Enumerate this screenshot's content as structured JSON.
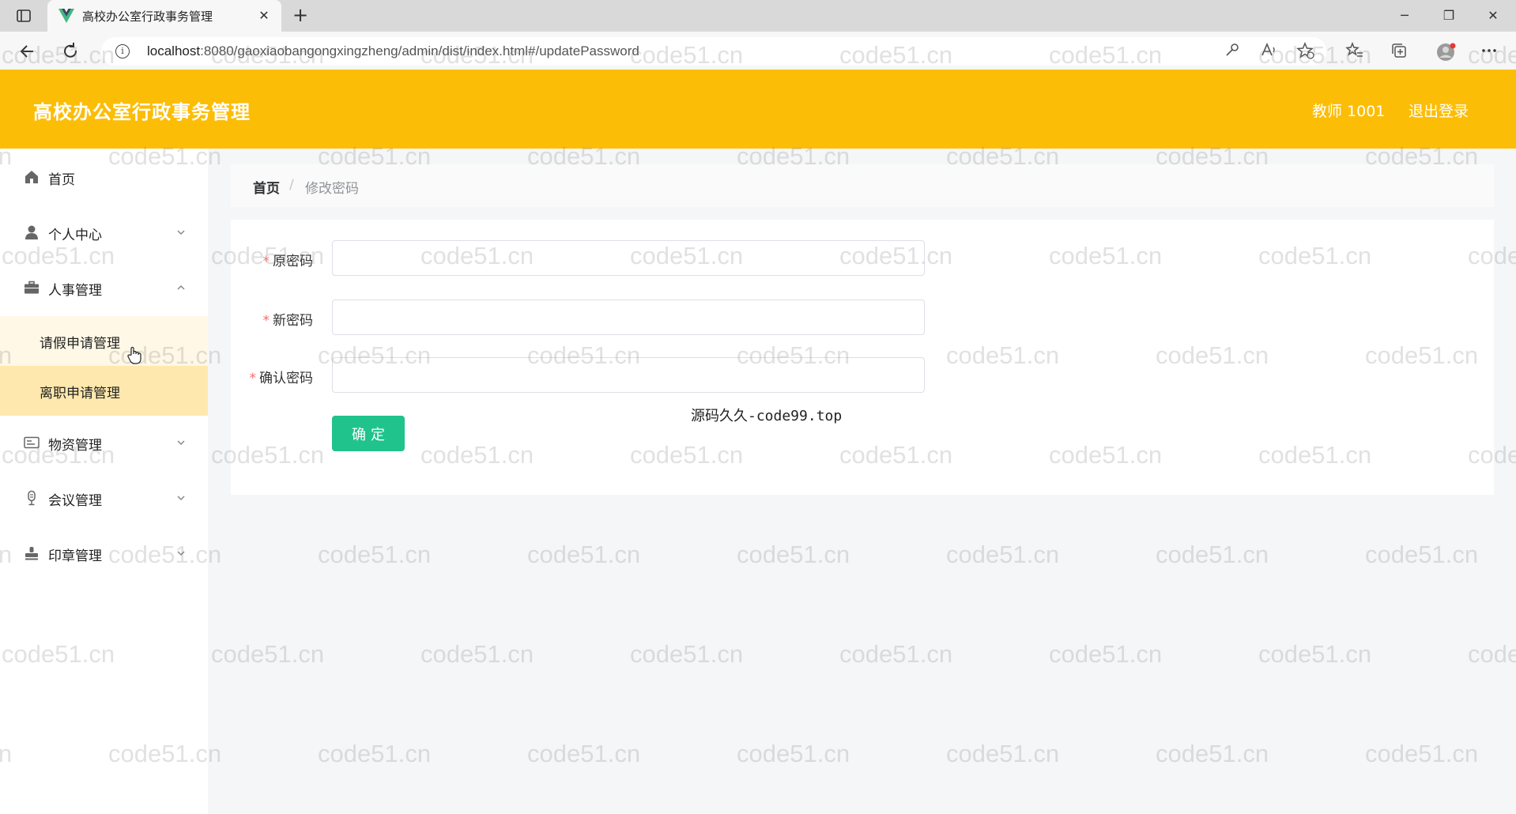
{
  "browser": {
    "tab_title": "高校办公室行政事务管理",
    "url_host": "localhost",
    "url_rest": ":8080/gaoxiaobangongxingzheng/admin/dist/index.html#/updatePassword"
  },
  "header": {
    "title": "高校办公室行政事务管理",
    "user": "教师 1001",
    "logout": "退出登录",
    "bg_color": "#fcbd06"
  },
  "sidebar": {
    "items": [
      {
        "label": "首页",
        "icon": "home-icon"
      },
      {
        "label": "个人中心",
        "icon": "user-icon",
        "expanded": false
      },
      {
        "label": "人事管理",
        "icon": "briefcase-icon",
        "expanded": true,
        "children": [
          {
            "label": "请假申请管理",
            "active": false
          },
          {
            "label": "离职申请管理",
            "active": true
          }
        ]
      },
      {
        "label": "物资管理",
        "icon": "card-icon",
        "expanded": false
      },
      {
        "label": "会议管理",
        "icon": "mic-icon",
        "expanded": false
      },
      {
        "label": "印章管理",
        "icon": "stamp-icon",
        "expanded": false
      }
    ]
  },
  "breadcrumb": {
    "home": "首页",
    "separator": "/",
    "current": "修改密码"
  },
  "form": {
    "fields": [
      {
        "label": "原密码",
        "required": true,
        "value": ""
      },
      {
        "label": "新密码",
        "required": true,
        "value": ""
      },
      {
        "label": "确认密码",
        "required": true,
        "value": ""
      }
    ],
    "submit_label": "确定",
    "submit_color": "#20c38b"
  },
  "source_note": "源码久久-code99.top",
  "watermark": "code51.cn"
}
